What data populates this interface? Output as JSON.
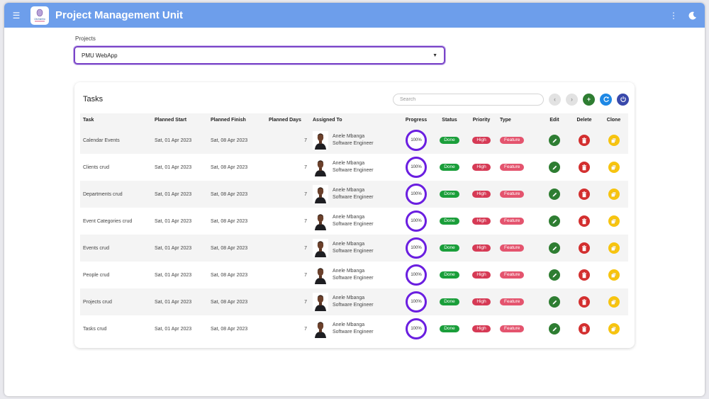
{
  "app": {
    "title": "Project Management Unit",
    "logo_text": "Ukuhamba"
  },
  "projects": {
    "label": "Projects",
    "selected": "PMU WebApp"
  },
  "tasks_card": {
    "title": "Tasks",
    "search_placeholder": "Search"
  },
  "table": {
    "headers": {
      "task": "Task",
      "start": "Planned Start",
      "finish": "Planned Finish",
      "days": "Planned Days",
      "assigned": "Assigned To",
      "progress": "Progress",
      "status": "Status",
      "priority": "Priority",
      "type": "Type",
      "edit": "Edit",
      "delete": "Delete",
      "clone": "Clone"
    },
    "rows": [
      {
        "task": "Calendar Events",
        "start": "Sat, 01 Apr 2023",
        "finish": "Sat, 08 Apr 2023",
        "days": "7",
        "name": "Anele Mbanga",
        "role": "Software Engineer",
        "progress": "100%",
        "status": "Done",
        "priority": "High",
        "type": "Feature"
      },
      {
        "task": "Clients crud",
        "start": "Sat, 01 Apr 2023",
        "finish": "Sat, 08 Apr 2023",
        "days": "7",
        "name": "Anele Mbanga",
        "role": "Software Engineer",
        "progress": "100%",
        "status": "Done",
        "priority": "High",
        "type": "Feature"
      },
      {
        "task": "Departments crud",
        "start": "Sat, 01 Apr 2023",
        "finish": "Sat, 08 Apr 2023",
        "days": "7",
        "name": "Anele Mbanga",
        "role": "Software Engineer",
        "progress": "100%",
        "status": "Done",
        "priority": "High",
        "type": "Feature"
      },
      {
        "task": "Event Categories crud",
        "start": "Sat, 01 Apr 2023",
        "finish": "Sat, 08 Apr 2023",
        "days": "7",
        "name": "Anele Mbanga",
        "role": "Software Engineer",
        "progress": "100%",
        "status": "Done",
        "priority": "High",
        "type": "Feature"
      },
      {
        "task": "Events crud",
        "start": "Sat, 01 Apr 2023",
        "finish": "Sat, 08 Apr 2023",
        "days": "7",
        "name": "Anele Mbanga",
        "role": "Software Engineer",
        "progress": "100%",
        "status": "Done",
        "priority": "High",
        "type": "Feature"
      },
      {
        "task": "People crud",
        "start": "Sat, 01 Apr 2023",
        "finish": "Sat, 08 Apr 2023",
        "days": "7",
        "name": "Anele Mbanga",
        "role": "Software Engineer",
        "progress": "100%",
        "status": "Done",
        "priority": "High",
        "type": "Feature"
      },
      {
        "task": "Projects crud",
        "start": "Sat, 01 Apr 2023",
        "finish": "Sat, 08 Apr 2023",
        "days": "7",
        "name": "Anele Mbanga",
        "role": "Software Engineer",
        "progress": "100%",
        "status": "Done",
        "priority": "High",
        "type": "Feature"
      },
      {
        "task": "Tasks crud",
        "start": "Sat, 01 Apr 2023",
        "finish": "Sat, 08 Apr 2023",
        "days": "7",
        "name": "Anele Mbanga",
        "role": "Software Engineer",
        "progress": "100%",
        "status": "Done",
        "priority": "High",
        "type": "Feature"
      }
    ]
  },
  "icons": {
    "menu": "menu-icon",
    "more": "more-vert-icon",
    "theme": "moon-icon",
    "prev": "chevron-left-icon",
    "next": "chevron-right-icon",
    "add": "plus-icon",
    "refresh": "refresh-icon",
    "power": "power-icon",
    "edit": "pencil-icon",
    "delete": "trash-icon",
    "clone": "copy-icon"
  },
  "colors": {
    "appbar": "#6d9eeb",
    "select_border": "#7a44c8",
    "progress_ring": "#6a1ee0",
    "done": "#1a9e3a",
    "high": "#d63a55",
    "feature": "#e4546e",
    "edit": "#2e7d32",
    "delete": "#d32f2f",
    "clone": "#f7c40f"
  }
}
